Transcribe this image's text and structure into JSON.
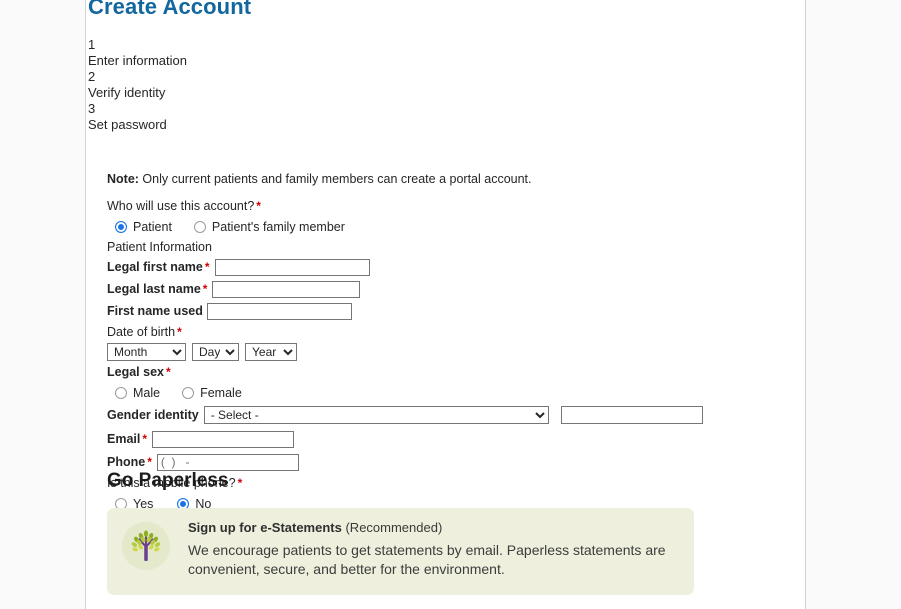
{
  "page": {
    "title": "Create Account",
    "title_color": "#12679f"
  },
  "steps": [
    {
      "number": "1",
      "label": "Enter information"
    },
    {
      "number": "2",
      "label": "Verify identity"
    },
    {
      "number": "3",
      "label": "Set password"
    }
  ],
  "form": {
    "note_prefix": "Note:",
    "note_text": " Only current patients and family members can create a portal account.",
    "account_user_question": "Who will use this account?",
    "account_user_options": [
      {
        "label": "Patient",
        "selected": true
      },
      {
        "label": "Patient's family member",
        "selected": false
      }
    ],
    "patient_information_label": "Patient Information",
    "legal_first_name_label": "Legal first name",
    "legal_first_name_value": "",
    "legal_last_name_label": "Legal last name",
    "legal_last_name_value": "",
    "first_name_used_label": "First name used",
    "first_name_used_value": "",
    "date_of_birth_label": "Date of birth",
    "month_select_value": "Month",
    "day_select_value": "Day",
    "year_select_value": "Year",
    "legal_sex_label": "Legal sex",
    "legal_sex_options": [
      {
        "label": "Male",
        "selected": false
      },
      {
        "label": "Female",
        "selected": false
      }
    ],
    "gender_identity_label": "Gender identity",
    "gender_identity_value": "- Select -",
    "gender_identity_other_value": "",
    "email_label": "Email",
    "email_value": "",
    "phone_label": "Phone",
    "phone_mask": "(  )   -",
    "mobile_phone_question": "Is this a mobile phone?",
    "mobile_phone_options": [
      {
        "label": "Yes",
        "selected": false
      },
      {
        "label": "No",
        "selected": true
      }
    ],
    "required_marker": "*"
  },
  "paperless": {
    "heading": "Go Paperless",
    "panel_title_bold": "Sign up for e-Statements",
    "panel_title_rest": " (Recommended)",
    "panel_body": "We encourage patients to get statements by email. Paperless statements are convenient, secure, and better for the environment.",
    "panel_bg": "#eef0dd",
    "icon": "tree-icon"
  }
}
